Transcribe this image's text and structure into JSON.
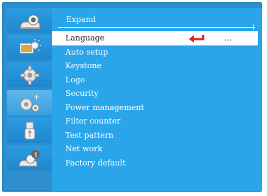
{
  "panel": {
    "title": "Expand",
    "items": [
      {
        "label": "Language",
        "value": "..."
      },
      {
        "label": "Auto setup"
      },
      {
        "label": "Keystone"
      },
      {
        "label": "Logo"
      },
      {
        "label": "Security"
      },
      {
        "label": "Power management"
      },
      {
        "label": "Filter counter"
      },
      {
        "label": "Test pattern"
      },
      {
        "label": "Net work"
      },
      {
        "label": "Factory default"
      }
    ],
    "selected_index": 0
  },
  "sidebar": {
    "tabs": [
      {
        "icon": "projector-icon"
      },
      {
        "icon": "picture-adjust-icon"
      },
      {
        "icon": "gear-icon"
      },
      {
        "icon": "expand-gears-icon",
        "active": true
      },
      {
        "icon": "usb-icon"
      },
      {
        "icon": "info-icon"
      }
    ]
  },
  "colors": {
    "frame": "#2f8fce",
    "panel": "#2aa5ea",
    "tab": "#1f86cc",
    "selected_row": "#ffffff",
    "enter_arrow": "#e02020"
  }
}
